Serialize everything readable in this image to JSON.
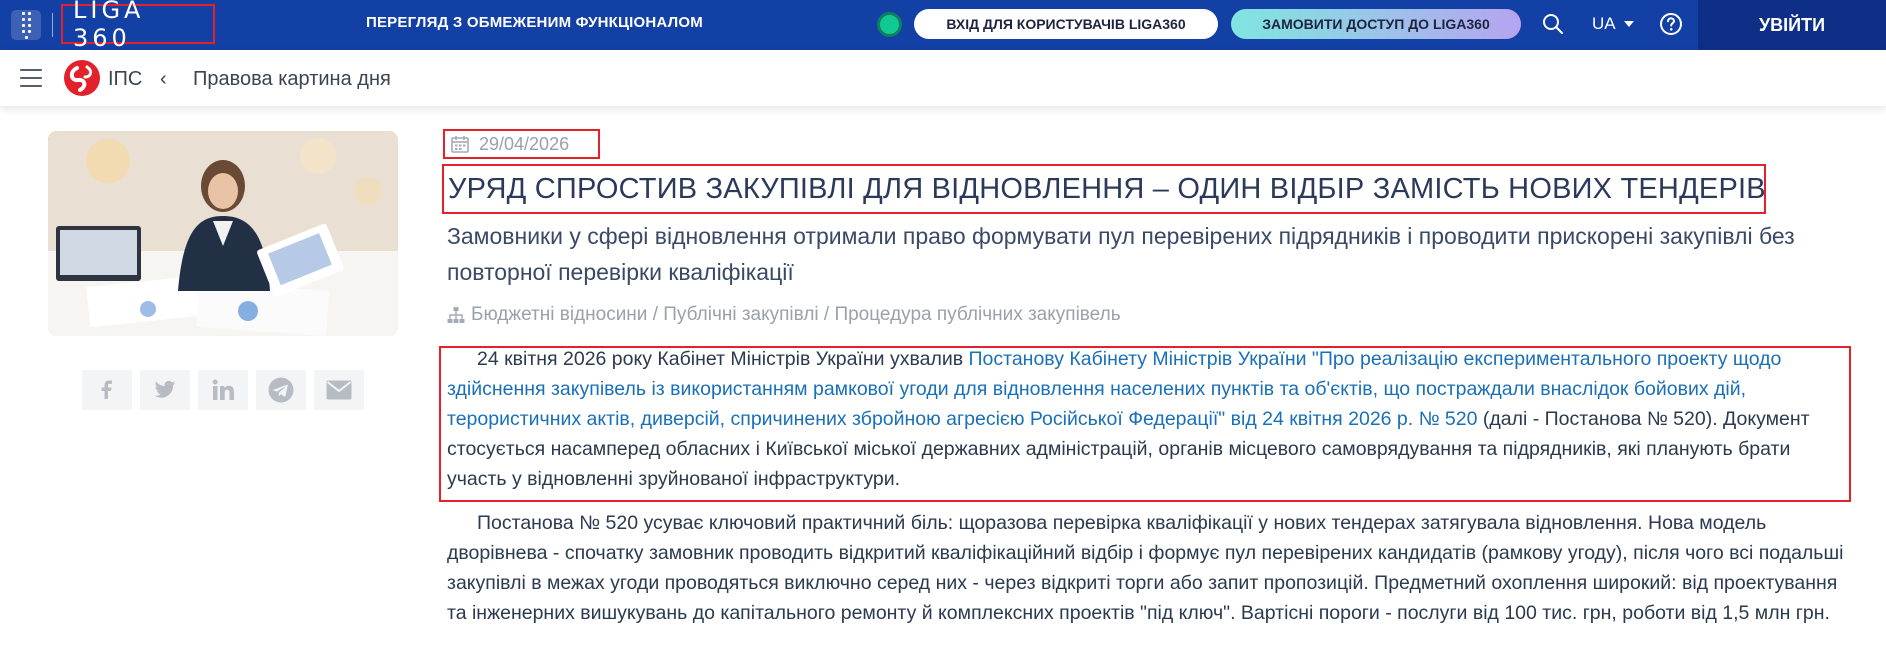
{
  "topbar": {
    "logo": "LIGA 360",
    "restricted_label": "ПЕРЕГЛЯД З ОБМЕЖЕНИМ ФУНКЦІОНАЛОМ",
    "login_users_label": "ВХІД ДЛЯ КОРИСТУВАЧІВ LIGA360",
    "order_access_label": "ЗАМОВИТИ ДОСТУП ДО LIGA360",
    "language": "UA",
    "exit_label": "УВІЙТИ"
  },
  "subbar": {
    "ips_label": "ІПС",
    "back_label": "‹",
    "section_title": "Правова картина дня"
  },
  "article": {
    "date": "29/04/2026",
    "headline": "УРЯД СПРОСТИВ ЗАКУПІВЛІ ДЛЯ ВІДНОВЛЕННЯ – ОДИН ВІДБІР ЗАМІСТЬ НОВИХ ТЕНДЕРІВ",
    "subtitle": "Замовники у сфері відновлення отримали право формувати пул перевірених підрядників і проводити прискорені закупівлі без повторної перевірки кваліфікації",
    "breadcrumb": "Бюджетні відносини / Публічні закупівлі / Процедура публічних закупівель",
    "para1_before": "24 квітня 2026 року Кабінет Міністрів України ухвалив ",
    "para1_link": "Постанову Кабінету Міністрів України \"Про реалізацію експериментального проекту щодо здійснення закупівель із використанням рамкової угоди для відновлення населених пунктів та об'єктів, що постраждали внаслідок бойових дій, терористичних актів, диверсій, спричинених збройною агресією Російської Федерації\" від 24 квітня 2026 р. № 520",
    "para1_after": " (далі - Постанова № 520). Документ стосується насамперед обласних і Київської міської державних адміністрацій, органів місцевого самоврядування та підрядників, які планують брати участь у відновленні зруйнованої інфраструктури.",
    "para2": "Постанова № 520 усуває ключовий практичний біль: щоразова перевірка кваліфікації у нових тендерах затягувала відновлення. Нова модель дворівнева - спочатку замовник проводить відкритий кваліфікаційний відбір і формує пул перевірених кандидатів (рамкову угоду), після чого всі подальші закупівлі в межах угоди проводяться виключно серед них - через відкриті торги або запит пропозицій. Предметний охоплення широкий: від проектування та інженерних вишукувань до капітального ремонту й комплексних проектів \"під ключ\". Вартісні пороги - послуги від 100 тис. грн, роботи від 1,5 млн грн."
  },
  "share": {
    "icons": [
      "facebook-icon",
      "twitter-icon",
      "linkedin-icon",
      "telegram-icon",
      "email-icon"
    ]
  },
  "colors": {
    "topbar": "#1340a5",
    "exit_button": "#0e2f86",
    "highlight_border": "#e3212b",
    "link": "#1a70b8",
    "status_dot": "#12c993",
    "ips_logo": "#e3212b"
  }
}
